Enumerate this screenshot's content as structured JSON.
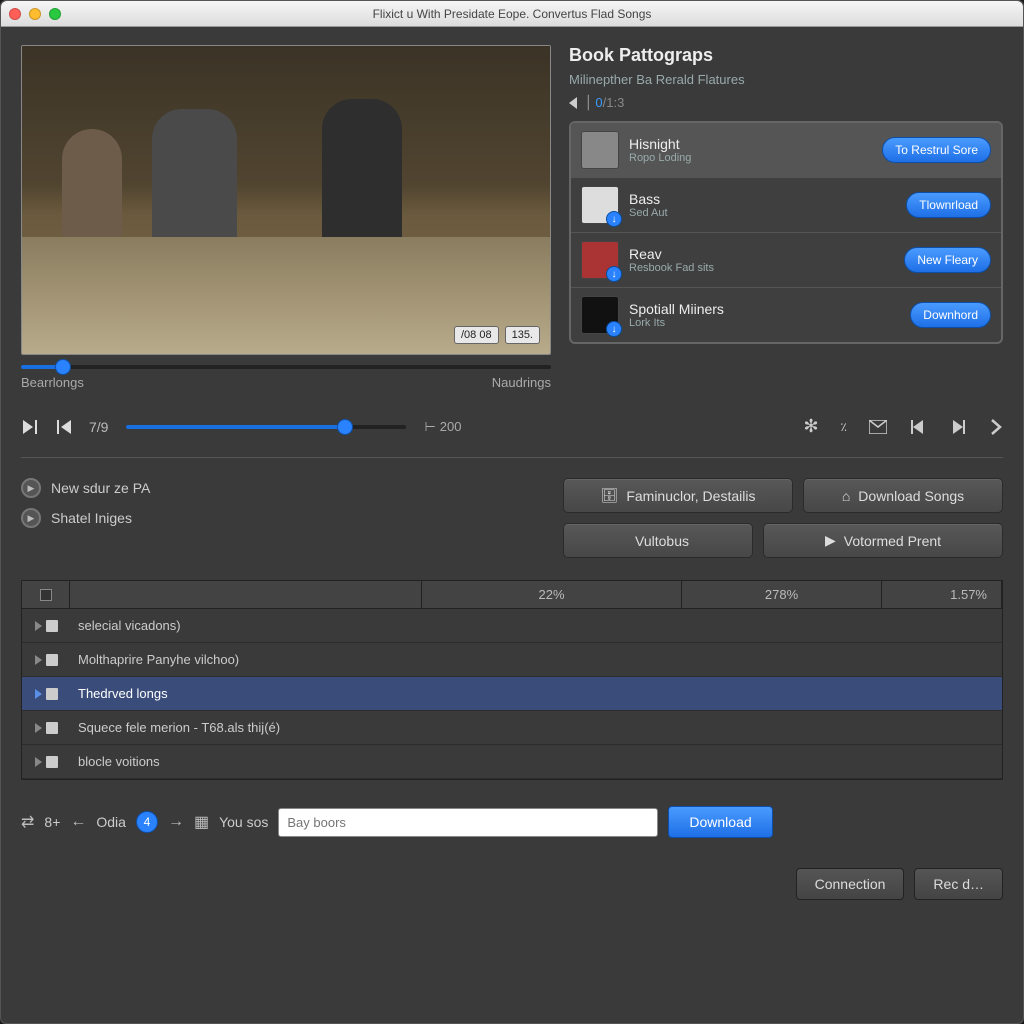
{
  "window": {
    "title": "Flixict u With Presidate Eope. Convertus Flad Songs"
  },
  "video": {
    "badge1": "/08 08",
    "badge2": "135.",
    "label_left": "Bearrlongs",
    "label_right": "Naudrings",
    "mini_slider_pct": 8
  },
  "side": {
    "title": "Book Pattograps",
    "subtitle": "Milinepther Ba Rerald Flatures",
    "counter_cur": "0",
    "counter_sep": "/1:3",
    "items": [
      {
        "title": "Hisnight",
        "sub": "Ropo Loding",
        "action": "To Restrul Sore"
      },
      {
        "title": "Bass",
        "sub": "Sed Aut",
        "action": "Tlownrload"
      },
      {
        "title": "Reav",
        "sub": "Resbook Fad sits",
        "action": "New Fleary"
      },
      {
        "title": "Spotiall Miiners",
        "sub": "Lork Its",
        "action": "Downhord"
      }
    ]
  },
  "playbar": {
    "count": "7/9",
    "slider_pct": 78,
    "end_marker": "200"
  },
  "midlist": {
    "item1": "New sdur ze PA",
    "item2": "Shatel Iniges"
  },
  "buttons": {
    "faminuclor": "Faminuclor, Destailis",
    "download_songs": "Download Songs",
    "vultobus": "Vultobus",
    "votormed": "Votormed Prent"
  },
  "table": {
    "h2": "22%",
    "h3": "278%",
    "h4": "1.57%",
    "rows": [
      {
        "name": "selecial vicadons)"
      },
      {
        "name": "Molthaprire Panyhe vilchoo)"
      },
      {
        "name": "Thedrved longs"
      },
      {
        "name": "Squece fele merion - T68.als thij(é)"
      },
      {
        "name": "blocle voitions"
      }
    ]
  },
  "bottom": {
    "prefix": "8+",
    "odia": "Odia",
    "badge": "4",
    "yousos": "You sos",
    "placeholder": "Bay boors",
    "download": "Download"
  },
  "footer": {
    "connection": "Connection",
    "rec": "Rec d…"
  }
}
